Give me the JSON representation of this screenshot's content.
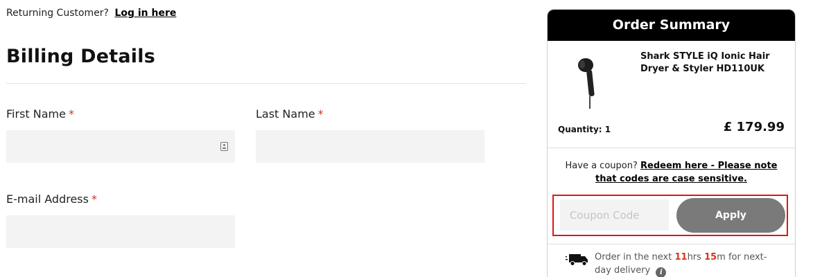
{
  "login_prompt": {
    "text": "Returning Customer?",
    "link": "Log in here"
  },
  "billing": {
    "title": "Billing Details",
    "required_mark": "*",
    "fields": {
      "first_name": {
        "label": "First Name",
        "value": ""
      },
      "last_name": {
        "label": "Last Name",
        "value": ""
      },
      "email": {
        "label": "E-mail Address",
        "value": ""
      }
    }
  },
  "summary": {
    "title": "Order Summary",
    "product": {
      "name": "Shark STYLE iQ Ionic Hair Dryer & Styler HD110UK",
      "quantity_text": "Quantity: 1",
      "price": "£ 179.99",
      "image_icon": "hair-dryer-image"
    },
    "coupon": {
      "prompt": "Have a coupon?",
      "link": "Redeem here - Please note that codes are case sensitive.",
      "placeholder": "Coupon Code",
      "apply_label": "Apply"
    },
    "delivery": {
      "prefix": "Order in the next",
      "hours": "11",
      "hours_unit": "hrs",
      "minutes": "15",
      "minutes_unit": "m",
      "suffix": "for next-day delivery",
      "info_glyph": "i"
    }
  },
  "colors": {
    "accent_red": "#e01414",
    "countdown": "#d5361a",
    "header_bg": "#000000",
    "apply_bg": "#7a7a7a"
  }
}
